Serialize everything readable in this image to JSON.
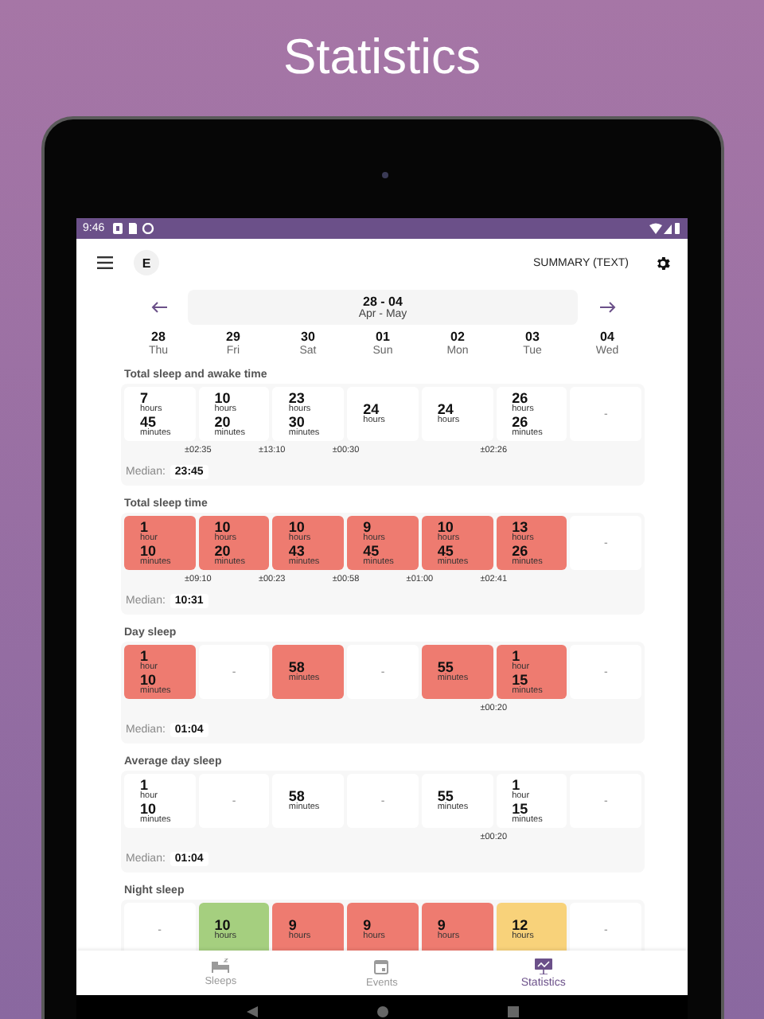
{
  "headline": "Statistics",
  "status_bar": {
    "time": "9:46"
  },
  "app_bar": {
    "avatar": "E",
    "action": "SUMMARY (TEXT)"
  },
  "date_range": {
    "days": "28 - 04",
    "months": "Apr - May"
  },
  "days": [
    {
      "date": "28",
      "weekday": "Thu"
    },
    {
      "date": "29",
      "weekday": "Fri"
    },
    {
      "date": "30",
      "weekday": "Sat"
    },
    {
      "date": "01",
      "weekday": "Sun"
    },
    {
      "date": "02",
      "weekday": "Mon"
    },
    {
      "date": "03",
      "weekday": "Tue"
    },
    {
      "date": "04",
      "weekday": "Wed"
    }
  ],
  "sections": [
    {
      "title": "Total sleep and awake time",
      "median_label": "Median:",
      "median": "23:45",
      "cells": [
        {
          "kind": "value",
          "color": "#ffffff",
          "parts": [
            {
              "value": "7",
              "unit": "hours"
            },
            {
              "value": "45",
              "unit": "minutes"
            }
          ],
          "diff": "±02:35"
        },
        {
          "kind": "value",
          "color": "#ffffff",
          "parts": [
            {
              "value": "10",
              "unit": "hours"
            },
            {
              "value": "20",
              "unit": "minutes"
            }
          ],
          "diff": "±13:10"
        },
        {
          "kind": "value",
          "color": "#ffffff",
          "parts": [
            {
              "value": "23",
              "unit": "hours"
            },
            {
              "value": "30",
              "unit": "minutes"
            }
          ],
          "diff": "±00:30"
        },
        {
          "kind": "value",
          "color": "#ffffff",
          "parts": [
            {
              "value": "24",
              "unit": "hours"
            }
          ]
        },
        {
          "kind": "value",
          "color": "#ffffff",
          "parts": [
            {
              "value": "24",
              "unit": "hours"
            }
          ],
          "diff": "±02:26"
        },
        {
          "kind": "value",
          "color": "#ffffff",
          "parts": [
            {
              "value": "26",
              "unit": "hours"
            },
            {
              "value": "26",
              "unit": "minutes"
            }
          ]
        },
        {
          "kind": "empty",
          "color": "#ffffff",
          "text": "-"
        }
      ]
    },
    {
      "title": "Total sleep time",
      "median_label": "Median:",
      "median": "10:31",
      "cells": [
        {
          "kind": "value",
          "color": "#ee7b70",
          "parts": [
            {
              "value": "1",
              "unit": "hour"
            },
            {
              "value": "10",
              "unit": "minutes"
            }
          ],
          "diff": "±09:10"
        },
        {
          "kind": "value",
          "color": "#ee7b70",
          "parts": [
            {
              "value": "10",
              "unit": "hours"
            },
            {
              "value": "20",
              "unit": "minutes"
            }
          ],
          "diff": "±00:23"
        },
        {
          "kind": "value",
          "color": "#ee7b70",
          "parts": [
            {
              "value": "10",
              "unit": "hours"
            },
            {
              "value": "43",
              "unit": "minutes"
            }
          ],
          "diff": "±00:58"
        },
        {
          "kind": "value",
          "color": "#ee7b70",
          "parts": [
            {
              "value": "9",
              "unit": "hours"
            },
            {
              "value": "45",
              "unit": "minutes"
            }
          ],
          "diff": "±01:00"
        },
        {
          "kind": "value",
          "color": "#ee7b70",
          "parts": [
            {
              "value": "10",
              "unit": "hours"
            },
            {
              "value": "45",
              "unit": "minutes"
            }
          ],
          "diff": "±02:41"
        },
        {
          "kind": "value",
          "color": "#ee7b70",
          "parts": [
            {
              "value": "13",
              "unit": "hours"
            },
            {
              "value": "26",
              "unit": "minutes"
            }
          ]
        },
        {
          "kind": "empty",
          "color": "#ffffff",
          "text": "-"
        }
      ]
    },
    {
      "title": "Day sleep",
      "median_label": "Median:",
      "median": "01:04",
      "cells": [
        {
          "kind": "value",
          "color": "#ee7b70",
          "parts": [
            {
              "value": "1",
              "unit": "hour"
            },
            {
              "value": "10",
              "unit": "minutes"
            }
          ]
        },
        {
          "kind": "empty",
          "color": "#ffffff",
          "text": "-"
        },
        {
          "kind": "value",
          "color": "#ee7b70",
          "parts": [
            {
              "value": "58",
              "unit": "minutes"
            }
          ]
        },
        {
          "kind": "empty",
          "color": "#ffffff",
          "text": "-"
        },
        {
          "kind": "value",
          "color": "#ee7b70",
          "parts": [
            {
              "value": "55",
              "unit": "minutes"
            }
          ],
          "diff": "±00:20"
        },
        {
          "kind": "value",
          "color": "#ee7b70",
          "parts": [
            {
              "value": "1",
              "unit": "hour"
            },
            {
              "value": "15",
              "unit": "minutes"
            }
          ]
        },
        {
          "kind": "empty",
          "color": "#ffffff",
          "text": "-"
        }
      ]
    },
    {
      "title": "Average day sleep",
      "median_label": "Median:",
      "median": "01:04",
      "cells": [
        {
          "kind": "value",
          "color": "#ffffff",
          "parts": [
            {
              "value": "1",
              "unit": "hour"
            },
            {
              "value": "10",
              "unit": "minutes"
            }
          ]
        },
        {
          "kind": "empty",
          "color": "#ffffff",
          "text": "-"
        },
        {
          "kind": "value",
          "color": "#ffffff",
          "parts": [
            {
              "value": "58",
              "unit": "minutes"
            }
          ]
        },
        {
          "kind": "empty",
          "color": "#ffffff",
          "text": "-"
        },
        {
          "kind": "value",
          "color": "#ffffff",
          "parts": [
            {
              "value": "55",
              "unit": "minutes"
            }
          ],
          "diff": "±00:20"
        },
        {
          "kind": "value",
          "color": "#ffffff",
          "parts": [
            {
              "value": "1",
              "unit": "hour"
            },
            {
              "value": "15",
              "unit": "minutes"
            }
          ]
        },
        {
          "kind": "empty",
          "color": "#ffffff",
          "text": "-"
        }
      ]
    },
    {
      "title": "Night sleep",
      "cells": [
        {
          "kind": "empty",
          "color": "#ffffff",
          "text": "-"
        },
        {
          "kind": "value",
          "color": "#a5cf7f",
          "parts": [
            {
              "value": "10",
              "unit": "hours"
            }
          ]
        },
        {
          "kind": "value",
          "color": "#ee7b70",
          "parts": [
            {
              "value": "9",
              "unit": "hours"
            }
          ]
        },
        {
          "kind": "value",
          "color": "#ee7b70",
          "parts": [
            {
              "value": "9",
              "unit": "hours"
            }
          ]
        },
        {
          "kind": "value",
          "color": "#ee7b70",
          "parts": [
            {
              "value": "9",
              "unit": "hours"
            }
          ]
        },
        {
          "kind": "value",
          "color": "#f8d27a",
          "parts": [
            {
              "value": "12",
              "unit": "hours"
            }
          ]
        },
        {
          "kind": "empty",
          "color": "#ffffff",
          "text": "-"
        }
      ]
    }
  ],
  "bottom_nav": [
    {
      "kind": "sleeps",
      "label": "Sleeps",
      "selected": false
    },
    {
      "kind": "events",
      "label": "Events",
      "selected": false
    },
    {
      "kind": "statistics",
      "label": "Statistics",
      "selected": true
    }
  ]
}
